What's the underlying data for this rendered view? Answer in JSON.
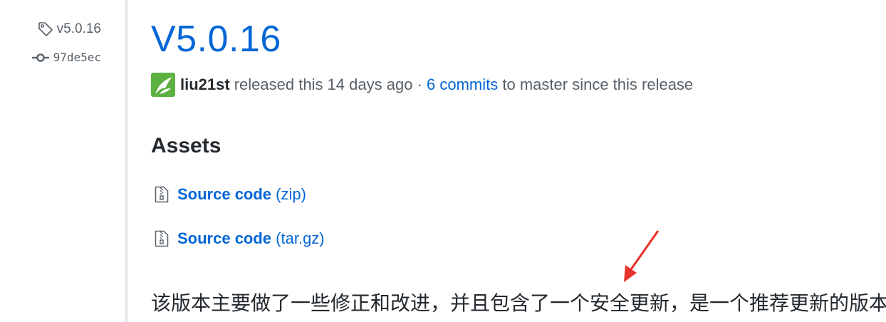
{
  "side_meta": {
    "tag_icon": "tag-icon",
    "tag": "v5.0.16",
    "commit_icon": "git-commit-icon",
    "commit": "97de5ec"
  },
  "release": {
    "title": "V5.0.16",
    "author": "liu21st",
    "released_text": "released this 14 days ago",
    "separator": "·",
    "commits_link": "6 commits",
    "since_text": "to master since this release"
  },
  "assets": {
    "heading": "Assets",
    "items": [
      {
        "icon": "file-zip-icon",
        "name": "Source code",
        "ext": "(zip)"
      },
      {
        "icon": "file-zip-icon",
        "name": "Source code",
        "ext": "(tar.gz)"
      }
    ]
  },
  "note": "该版本主要做了一些修正和改进，并且包含了一个安全更新，是一个推荐更新的版本。",
  "annotation": {
    "icon": "red-arrow-icon",
    "color": "#e8302a"
  },
  "colors": {
    "link": "#0366d6",
    "text": "#24292e",
    "muted": "#586069",
    "avatar_green": "#5db042"
  }
}
